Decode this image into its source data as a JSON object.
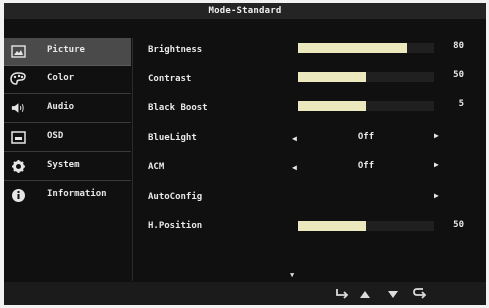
{
  "header": {
    "title": "Mode-Standard"
  },
  "sidebar": {
    "items": [
      {
        "label": "Picture",
        "icon": "picture-icon",
        "active": true
      },
      {
        "label": "Color",
        "icon": "palette-icon",
        "active": false
      },
      {
        "label": "Audio",
        "icon": "speaker-icon",
        "active": false
      },
      {
        "label": "OSD",
        "icon": "osd-icon",
        "active": false
      },
      {
        "label": "System",
        "icon": "gear-icon",
        "active": false
      },
      {
        "label": "Information",
        "icon": "info-icon",
        "active": false
      }
    ]
  },
  "settings": {
    "brightness": {
      "label": "Brightness",
      "value": "80"
    },
    "contrast": {
      "label": "Contrast",
      "value": "50"
    },
    "black_boost": {
      "label": "Black Boost",
      "value": "5"
    },
    "blue_light": {
      "label": "BlueLight",
      "value": "Off"
    },
    "acm": {
      "label": "ACM",
      "value": "Off"
    },
    "auto_config": {
      "label": "AutoConfig"
    },
    "h_position": {
      "label": "H.Position",
      "value": "50"
    }
  },
  "footer": {
    "buttons": [
      "enter-icon",
      "up-icon",
      "down-icon",
      "back-icon"
    ]
  },
  "colors": {
    "background": "#101010",
    "accent": "#ece8bd",
    "selected_menu": "#4a4a4a"
  }
}
